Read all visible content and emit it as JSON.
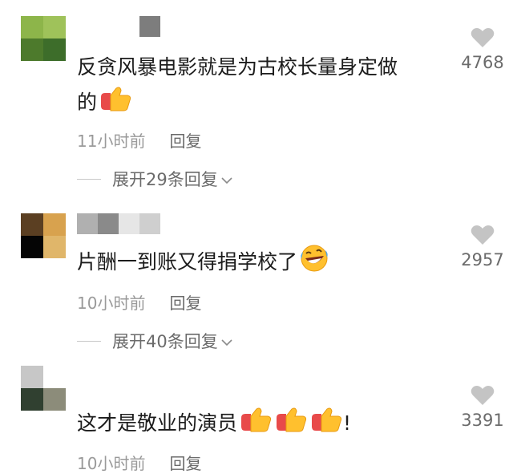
{
  "comments": [
    {
      "avatar_colors": [
        "#8db54a",
        "#9fc25a",
        "#4d7a2c",
        "#3d6d2a"
      ],
      "username_colors": [
        "#ffffff",
        "#ffffff",
        "#ffffff",
        "#7d7d7d"
      ],
      "text_line1": "反贪风暴电影就是为古校长量身定做",
      "text_line2": "的",
      "time": "11小时前",
      "reply": "回复",
      "expand": "展开29条回复",
      "likes": "4768"
    },
    {
      "avatar_colors": [
        "#5b3f22",
        "#d8a24e",
        "#050505",
        "#e0b66a"
      ],
      "username_colors": [
        "#b0b0b0",
        "#8a8a8a",
        "#e6e6e6",
        "#cfcfcf"
      ],
      "text_line1": "片酬一到账又得捐学校了",
      "time": "10小时前",
      "reply": "回复",
      "expand": "展开40条回复",
      "likes": "2957"
    },
    {
      "avatar_colors": [
        "#c7c7c7",
        "#ffffff",
        "#304030",
        "#8c8c7a"
      ],
      "text_line1": "这才是敬业的演员",
      "text_tail": "!",
      "time": "10小时前",
      "reply": "回复",
      "likes": "3391"
    }
  ],
  "icons": {
    "thumbs_up": "thumbs-up-emoji",
    "laugh": "rolling-laughing-emoji",
    "heart": "heart-icon",
    "chevron": "chevron-down-icon"
  },
  "colors": {
    "text": "#1c1c1c",
    "meta": "#9a9a9a",
    "heart": "#c4c4c4",
    "emoji_yellow": "#ffc02e",
    "emoji_red": "#e84a4a"
  }
}
